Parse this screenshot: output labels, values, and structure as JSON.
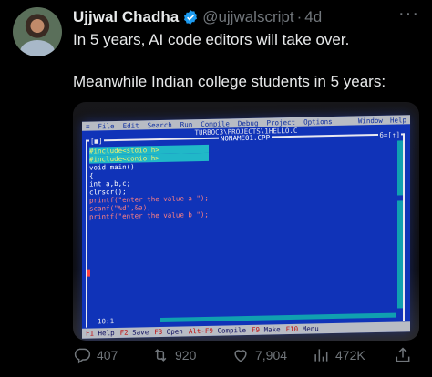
{
  "author": {
    "name": "Ujjwal Chadha",
    "handle": "@ujjwalscript",
    "separator": "·",
    "time": "4d",
    "verified_icon": "verified-badge-icon",
    "avatar_icon": "avatar-photo"
  },
  "more_label": "···",
  "tweet": {
    "line1": "In 5 years, AI code editors will take over.",
    "line2": "Meanwhile Indian college students in 5 years:"
  },
  "photo": {
    "menu": [
      "File",
      "Edit",
      "Search",
      "Run",
      "Compile",
      "Debug",
      "Project",
      "Options"
    ],
    "menu_right": [
      "Window",
      "Help"
    ],
    "path": "TURBOC3\\PROJECTS\\1HELLO.C",
    "close_box": "[■]",
    "window_title": "NONAME01.CPP",
    "window_number": "6=[↑]",
    "code_lines": [
      "#include<stdio.h>",
      "#include<conio.h>",
      "void main()",
      "{",
      "int a,b,c;",
      "clrscr();",
      "printf(\"enter the value a \");",
      "scanf(\"%d\",&a);",
      "printf(\"enter the value b \");"
    ],
    "cursor_pos": "10:1",
    "function_keys": [
      {
        "key": "F1",
        "label": "Help"
      },
      {
        "key": "F2",
        "label": "Save"
      },
      {
        "key": "F3",
        "label": "Open"
      },
      {
        "key": "Alt-F9",
        "label": "Compile"
      },
      {
        "key": "F9",
        "label": "Make"
      },
      {
        "key": "F10",
        "label": "Menu"
      }
    ]
  },
  "actions": {
    "replies": "407",
    "reposts": "920",
    "likes": "7,904",
    "views": "472K"
  },
  "colors": {
    "background": "#000000",
    "text": "#e7e9ea",
    "muted": "#71767b",
    "verified": "#1d9bf0",
    "turbo_blue": "#1033b8"
  }
}
